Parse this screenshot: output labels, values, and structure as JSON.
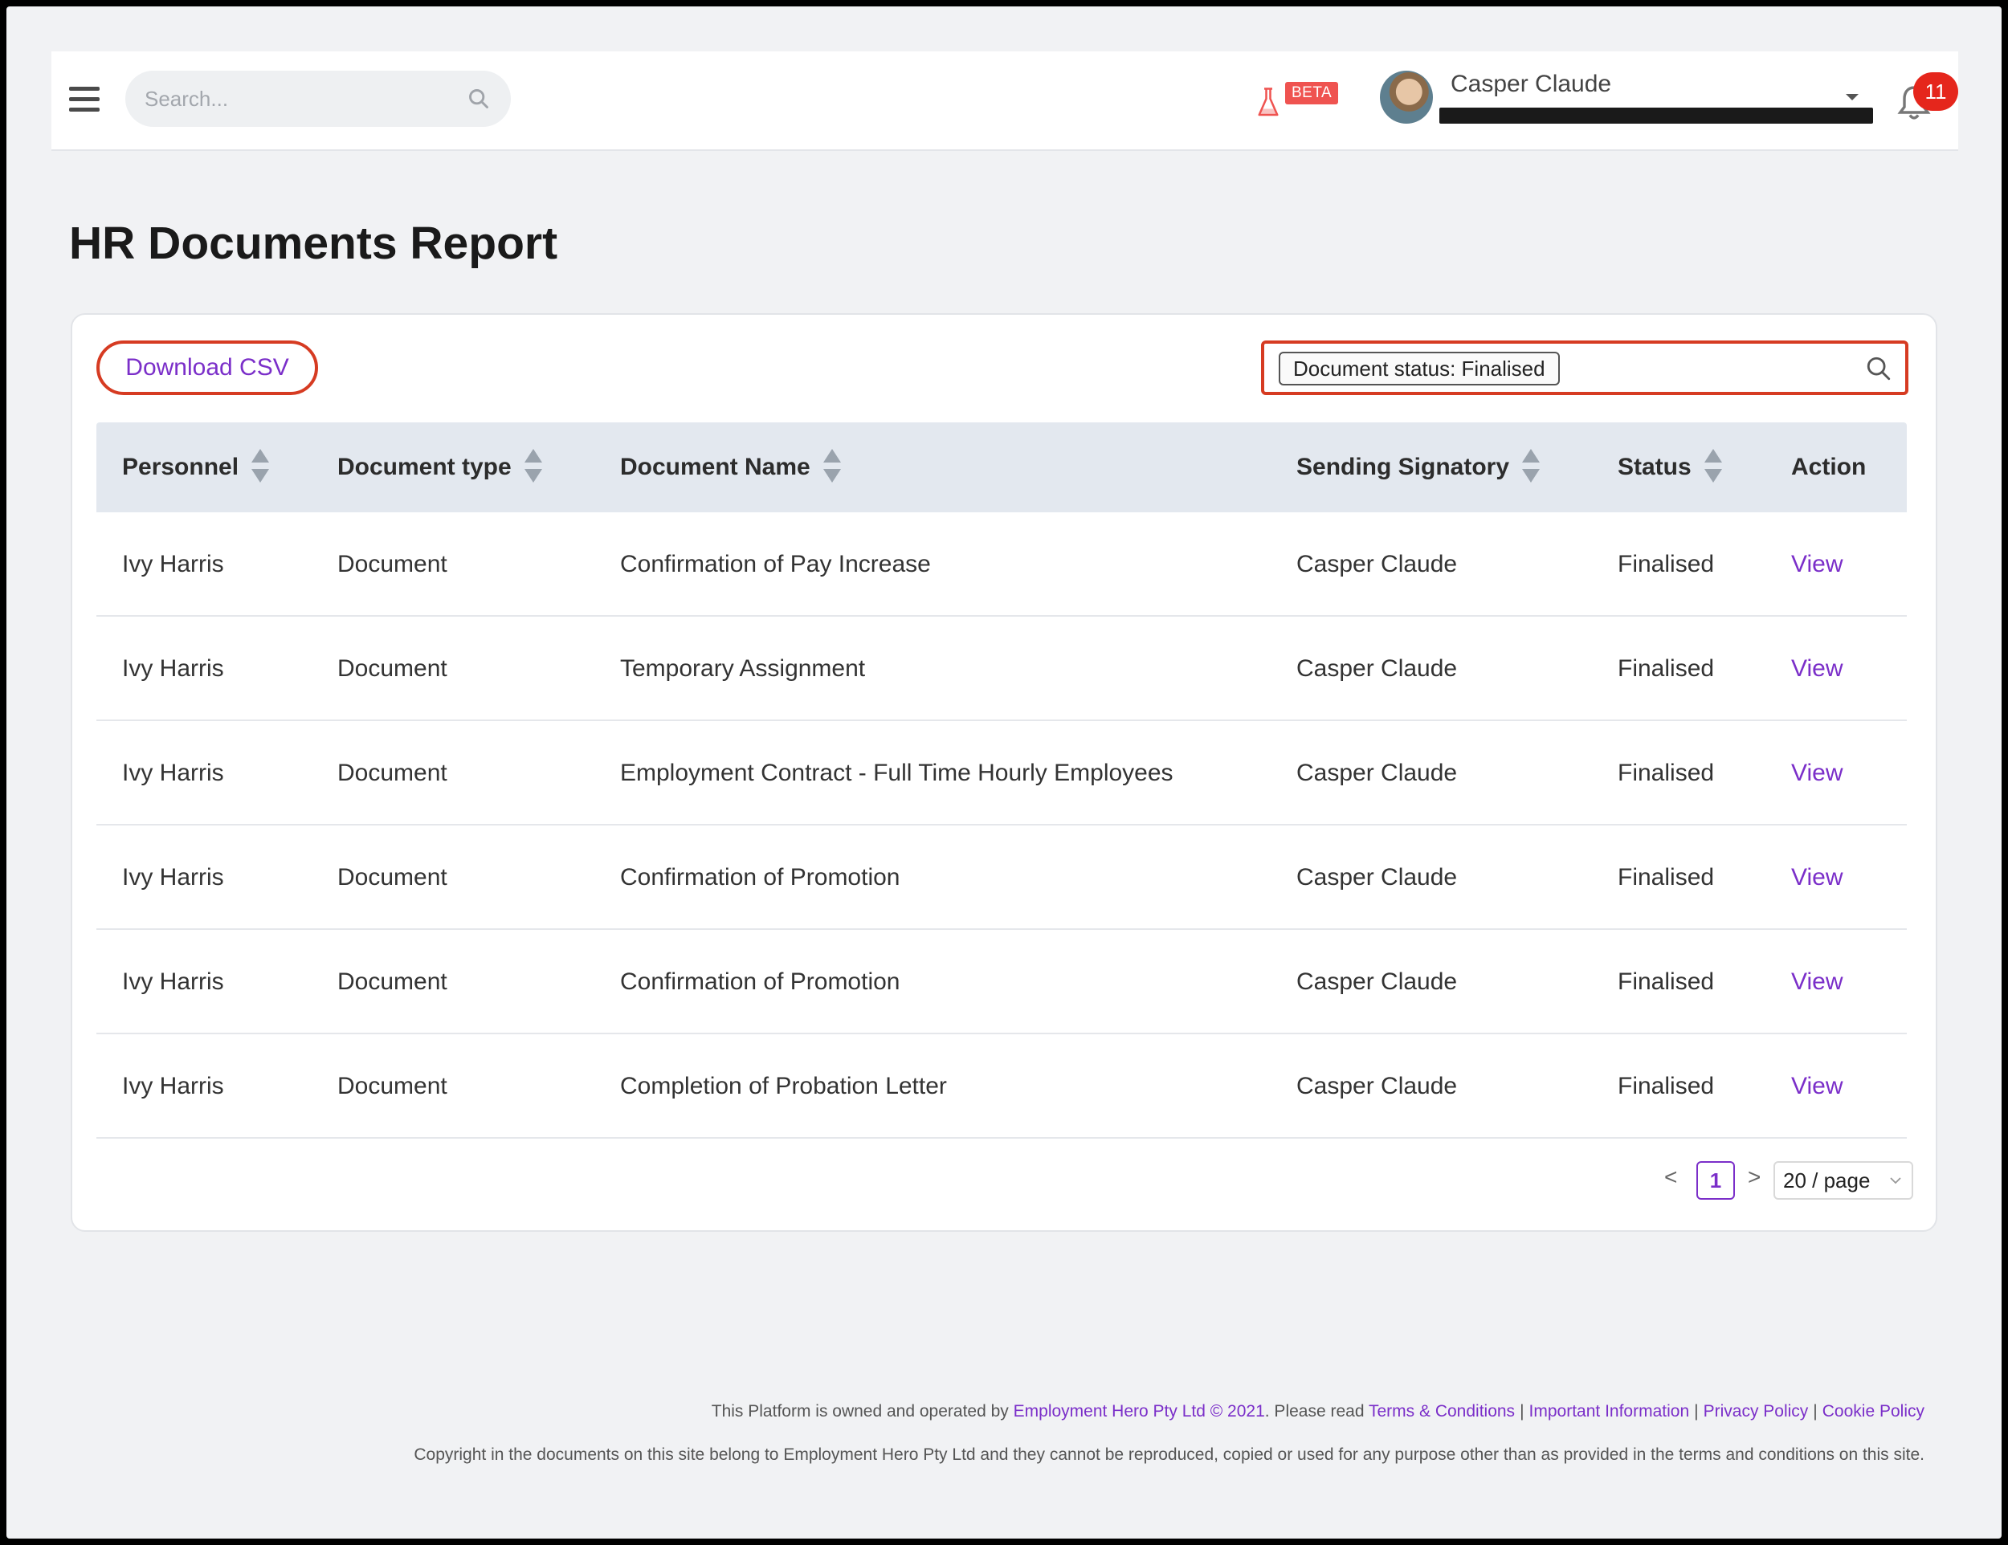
{
  "header": {
    "search_placeholder": "Search...",
    "beta_label": "BETA",
    "user_name": "Casper Claude",
    "notification_count": "11"
  },
  "page": {
    "title": "HR Documents Report"
  },
  "toolbar": {
    "download_csv_label": "Download CSV",
    "filter_tag": "Document status: Finalised"
  },
  "table": {
    "columns": [
      "Personnel",
      "Document type",
      "Document Name",
      "Sending Signatory",
      "Status",
      "Action"
    ],
    "rows": [
      {
        "personnel": "Ivy Harris",
        "type": "Document",
        "name": "Confirmation of Pay Increase",
        "signatory": "Casper Claude",
        "status": "Finalised",
        "action": "View"
      },
      {
        "personnel": "Ivy Harris",
        "type": "Document",
        "name": "Temporary Assignment",
        "signatory": "Casper Claude",
        "status": "Finalised",
        "action": "View"
      },
      {
        "personnel": "Ivy Harris",
        "type": "Document",
        "name": "Employment Contract - Full Time Hourly Employees",
        "signatory": "Casper Claude",
        "status": "Finalised",
        "action": "View"
      },
      {
        "personnel": "Ivy Harris",
        "type": "Document",
        "name": "Confirmation of Promotion",
        "signatory": "Casper Claude",
        "status": "Finalised",
        "action": "View"
      },
      {
        "personnel": "Ivy Harris",
        "type": "Document",
        "name": "Confirmation of Promotion",
        "signatory": "Casper Claude",
        "status": "Finalised",
        "action": "View"
      },
      {
        "personnel": "Ivy Harris",
        "type": "Document",
        "name": "Completion of Probation Letter",
        "signatory": "Casper Claude",
        "status": "Finalised",
        "action": "View"
      }
    ]
  },
  "pagination": {
    "prev": "<",
    "current": "1",
    "next": ">",
    "page_size": "20 / page"
  },
  "footer": {
    "line1_prefix": "This Platform is owned and operated by",
    "company_link": "Employment Hero Pty Ltd © 2021",
    "line1_mid": ". Please read",
    "terms_link": "Terms & Conditions",
    "important_link": "Important Information",
    "privacy_link": "Privacy Policy",
    "cookie_link": "Cookie Policy",
    "copyright": "Copyright in the documents on this site belong to Employment Hero Pty Ltd and they cannot be reproduced, copied or used for any purpose other than as provided in the terms and conditions on this site."
  },
  "colors": {
    "accent": "#7b2fc9",
    "highlight_border": "#d63b22",
    "badge": "#e5261c",
    "header_row_bg": "#e3e8ef"
  },
  "icons": [
    "hamburger-icon",
    "search-icon",
    "flask-icon",
    "caret-down-icon",
    "bell-icon",
    "sort-icon",
    "chevron-down-icon"
  ]
}
